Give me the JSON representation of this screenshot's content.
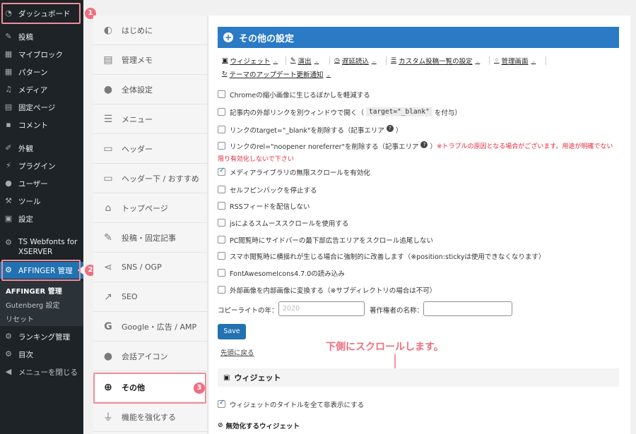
{
  "sidebar": {
    "items": [
      {
        "label": "ダッシュボード",
        "icon": "dashboard-icon"
      },
      {
        "label": "投稿",
        "icon": "pin-icon"
      },
      {
        "label": "マイブロック",
        "icon": "blocks-icon"
      },
      {
        "label": "パターン",
        "icon": "blocks-icon"
      },
      {
        "label": "メディア",
        "icon": "media-icon"
      },
      {
        "label": "固定ページ",
        "icon": "page-icon"
      },
      {
        "label": "コメント",
        "icon": "comment-icon"
      },
      {
        "label": "外観",
        "icon": "brush-icon"
      },
      {
        "label": "プラグイン",
        "icon": "plugin-icon"
      },
      {
        "label": "ユーザー",
        "icon": "user-icon"
      },
      {
        "label": "ツール",
        "icon": "wrench-icon"
      },
      {
        "label": "設定",
        "icon": "settings-icon"
      },
      {
        "label": "TS Webfonts for XSERVER",
        "icon": "gear-icon"
      },
      {
        "label": "AFFINGER 管理",
        "icon": "gear-icon"
      },
      {
        "label": "ランキング管理",
        "icon": "gear-icon"
      },
      {
        "label": "目次",
        "icon": "gear-icon"
      },
      {
        "label": "メニューを閉じる",
        "icon": "collapse-icon"
      }
    ],
    "submenu": [
      "AFFINGER 管理",
      "Gutenberg 設定",
      "リセット"
    ],
    "badges": [
      "1",
      "2"
    ]
  },
  "tabs": {
    "items": [
      {
        "label": "はじめに",
        "icon": "shield-icon"
      },
      {
        "label": "管理メモ",
        "icon": "memo-icon"
      },
      {
        "label": "全体設定",
        "icon": "palette-icon"
      },
      {
        "label": "メニュー",
        "icon": "menu-icon"
      },
      {
        "label": "ヘッダー",
        "icon": "header-icon"
      },
      {
        "label": "ヘッダー下 / おすすめ",
        "icon": "header-icon"
      },
      {
        "label": "トップページ",
        "icon": "home-icon"
      },
      {
        "label": "投稿・固定記事",
        "icon": "edit-icon"
      },
      {
        "label": "SNS / OGP",
        "icon": "share-icon"
      },
      {
        "label": "SEO",
        "icon": "chart-icon"
      },
      {
        "label": "Google・広告 / AMP",
        "icon": "google-icon"
      },
      {
        "label": "会話アイコン",
        "icon": "chat-icon"
      },
      {
        "label": "その他",
        "icon": "plus-circle-icon"
      },
      {
        "label": "機能を強化する",
        "icon": "plug-icon"
      }
    ],
    "badge": "3"
  },
  "main": {
    "title": "その他の設定",
    "nav": [
      {
        "label": "ウィジェット",
        "icon": "widget-icon"
      },
      {
        "label": "演出",
        "icon": "edit-icon"
      },
      {
        "label": "遅延読込",
        "icon": "clock-icon"
      },
      {
        "label": "カスタム投稿一覧の設定",
        "icon": "list-icon"
      },
      {
        "label": "管理画面",
        "icon": "dots-icon"
      },
      {
        "label": "テーマのアップデート更新通知",
        "icon": "refresh-icon"
      }
    ],
    "options": {
      "o1": "Chromeの縮小画像に生じるぼかしを軽減する",
      "o2a": "記事内の外部リンクを別ウィンドウで開く（",
      "o2code": "target=\"_blank\"",
      "o2b": "を付与）",
      "o3a": "リンクのtarget=\"_blank\"を削除する（記事エリア",
      "o3b": "）",
      "o4a": "リンクのrel=\"noopener noreferrer\"を削除する（記事エリア",
      "o4b": "）",
      "o4warn1": "※トラブルの原因となる場合がございます。用途が明確でない",
      "o4warn2": "限り有効化しないで下さい",
      "o5": "メディアライブラリの無限スクロールを有効化",
      "o6": "セルフピンバックを停止する",
      "o7": "RSSフィードを配信しない",
      "o8": "jsによるスムーススクロールを使用する",
      "o9": "PC閲覧時にサイドバーの最下部広告エリアをスクロール追尾しない",
      "o10": "スマホ閲覧時に横揺れが生じる場合に強制的に改善します（※position:stickyは使用できなくなります）",
      "o11": "FontAwesomeIcons4.7.0の読み込み",
      "o12": "外部画像を内部画像に変換する（※サブディレクトリの場合は不可）"
    },
    "q_mark": "?",
    "copyright_label": "コピーライトの年：",
    "copyright_placeholder": "2020",
    "author_label": "著作権者の名称：",
    "save_label": "Save",
    "back_to_top": "先頭に戻る",
    "scroll_note": "下側にスクロールします。",
    "widget_section_title": "ウィジェット",
    "widget_opt1": "ウィジェットのタイトルを全て非表示にする",
    "disabled_widgets_title": "無効化するウィジェット"
  },
  "colors": {
    "accent": "#2271b1",
    "header_blue": "#2a7ac5",
    "highlight_pink": "#f06e7e"
  }
}
